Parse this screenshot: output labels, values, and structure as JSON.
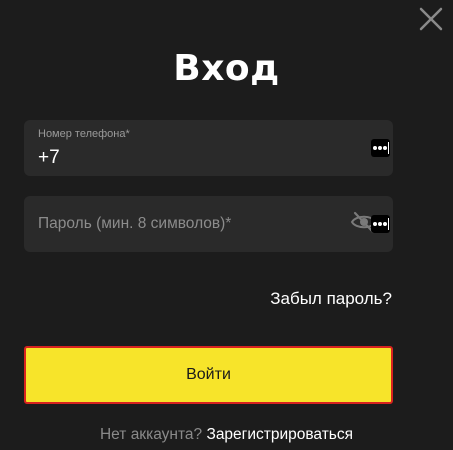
{
  "dialog": {
    "title": "Вход",
    "close_icon": "close-icon"
  },
  "phone": {
    "label": "Номер телефона*",
    "value": "+7",
    "keyboard_icon": "keyboard-icon"
  },
  "password": {
    "placeholder": "Пароль (мин. 8 символов)*",
    "visibility_icon": "eye-hidden-icon",
    "keyboard_icon": "keyboard-icon"
  },
  "forgot_link": "Забыл пароль?",
  "login_button": "Войти",
  "signup": {
    "prompt": "Нет аккаунта?",
    "link": "Зарегистрироваться"
  },
  "colors": {
    "background": "#1c1c1c",
    "field_background": "#2a2a2a",
    "accent_yellow": "#f7e42a",
    "focus_border": "#d8231f"
  }
}
